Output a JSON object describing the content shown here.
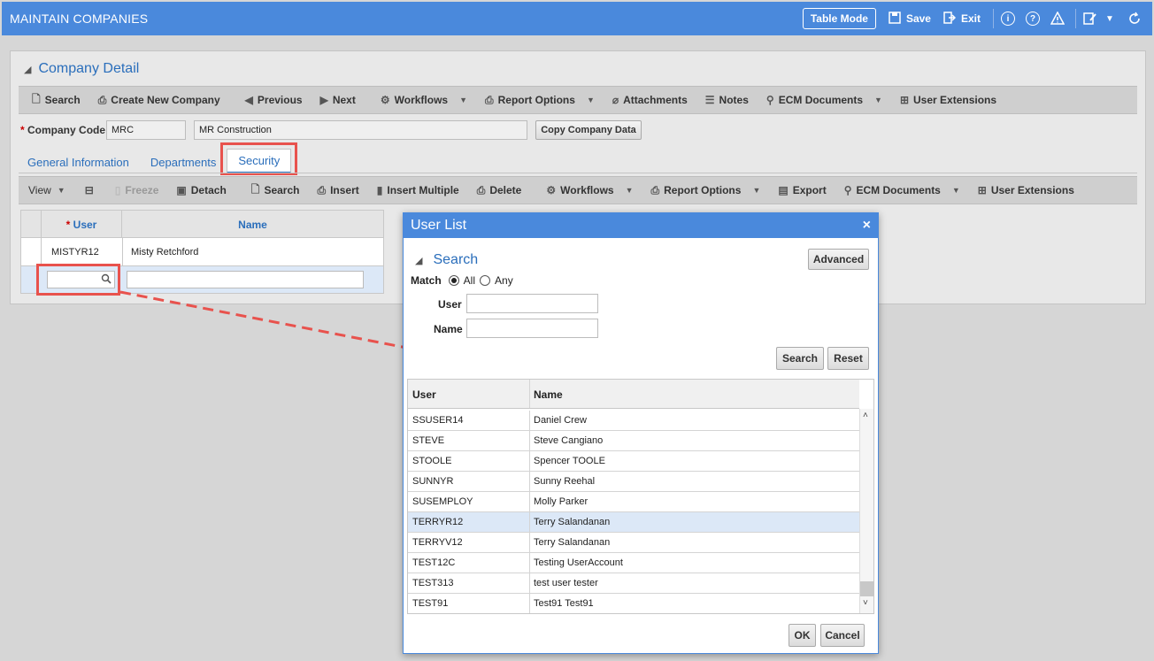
{
  "window": {
    "title": "MAINTAIN COMPANIES",
    "table_mode": "Table Mode",
    "save": "Save",
    "exit": "Exit"
  },
  "panel": {
    "title": "Company Detail",
    "toolbar": [
      {
        "label": "Search",
        "icon": "search-doc-icon"
      },
      {
        "label": "Create New Company",
        "icon": "print-icon"
      },
      {
        "label": "Previous",
        "icon": "arrow-left-icon"
      },
      {
        "label": "Next",
        "icon": "arrow-right-icon"
      },
      {
        "label": "Workflows",
        "icon": "gears-icon"
      },
      {
        "label": "Report Options",
        "icon": "printer-icon"
      },
      {
        "label": "Attachments",
        "icon": "paperclip-icon"
      },
      {
        "label": "Notes",
        "icon": "notes-icon"
      },
      {
        "label": "ECM Documents",
        "icon": "pin-icon"
      },
      {
        "label": "User Extensions",
        "icon": "hierarchy-icon"
      }
    ],
    "company_code_label": "Company Code",
    "company_code": "MRC",
    "company_name": "MR Construction",
    "copy_button": "Copy Company Data",
    "tabs": [
      "General Information",
      "Departments",
      "Security"
    ],
    "grid_toolbar": {
      "view": "View",
      "freeze": "Freeze",
      "detach": "Detach",
      "search": "Search",
      "insert": "Insert",
      "insert_multiple": "Insert Multiple",
      "delete": "Delete",
      "workflows": "Workflows",
      "report_options": "Report Options",
      "export": "Export",
      "ecm_documents": "ECM Documents",
      "user_extensions": "User Extensions"
    },
    "grid": {
      "col_user": "User",
      "col_name": "Name",
      "rows": [
        {
          "user": "MISTYR12",
          "name": "Misty Retchford"
        }
      ]
    }
  },
  "dialog": {
    "title": "User List",
    "search_title": "Search",
    "advanced": "Advanced",
    "match_label": "Match",
    "match_all": "All",
    "match_any": "Any",
    "user_label": "User",
    "name_label": "Name",
    "search_btn": "Search",
    "reset_btn": "Reset",
    "col_user": "User",
    "col_name": "Name",
    "rows": [
      {
        "user": "SSUSER14",
        "name": "Daniel Crew"
      },
      {
        "user": "STEVE",
        "name": "Steve Cangiano"
      },
      {
        "user": "STOOLE",
        "name": "Spencer TOOLE"
      },
      {
        "user": "SUNNYR",
        "name": "Sunny Reehal"
      },
      {
        "user": "SUSEMPLOY",
        "name": "Molly Parker"
      },
      {
        "user": "TERRYR12",
        "name": "Terry Salandanan"
      },
      {
        "user": "TERRYV12",
        "name": "Terry Salandanan"
      },
      {
        "user": "TEST12C",
        "name": "Testing UserAccount"
      },
      {
        "user": "TEST313",
        "name": "test user tester"
      },
      {
        "user": "TEST91",
        "name": "Test91 Test91"
      }
    ],
    "selected_row": 5,
    "ok": "OK",
    "cancel": "Cancel"
  },
  "colors": {
    "title_bar": "#4a89dc",
    "link_blue": "#2a6ebb",
    "highlight_red": "#e8524d",
    "selected_row": "#dce8f7"
  }
}
